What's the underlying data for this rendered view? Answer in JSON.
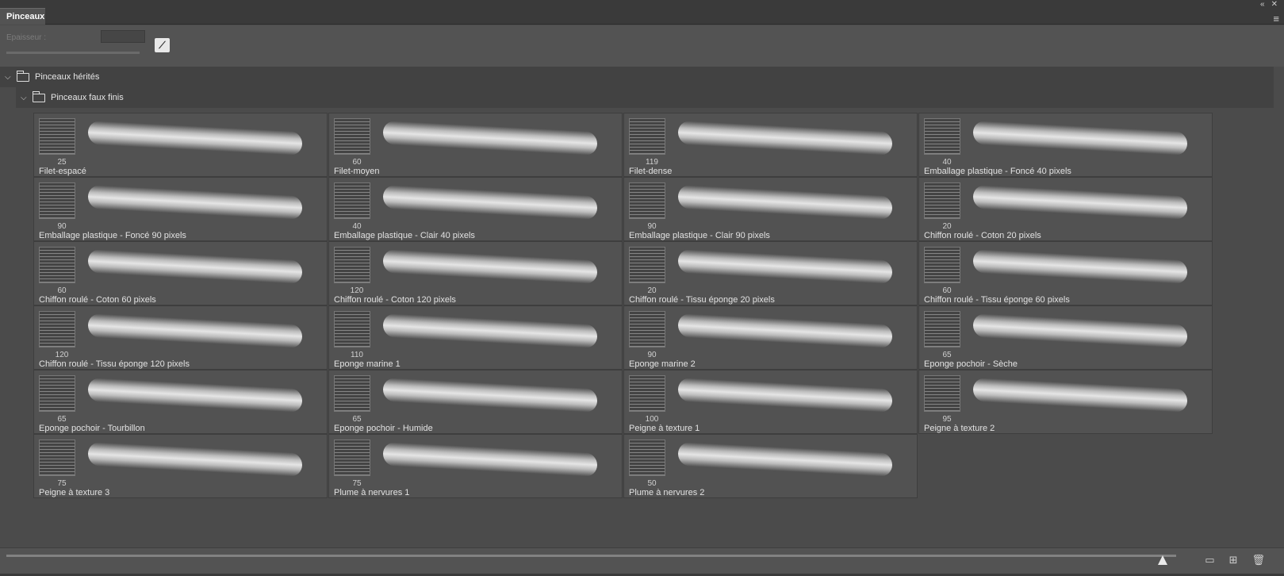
{
  "panel": {
    "tab_label": "Pinceaux",
    "collapse_icon": "double-chevron-left-icon",
    "close_icon": "close-icon",
    "menu_icon": "menu-icon"
  },
  "options": {
    "thickness_label": "Epaisseur :",
    "thickness_value": ""
  },
  "groups": {
    "parent": "Pinceaux hérités",
    "child": "Pinceaux faux finis"
  },
  "brushes": [
    {
      "name": "Filet-espacé",
      "size": "25"
    },
    {
      "name": "Filet-moyen",
      "size": "60"
    },
    {
      "name": "Filet-dense",
      "size": "119"
    },
    {
      "name": "Emballage plastique - Foncé 40 pixels",
      "size": "40"
    },
    {
      "name": "Emballage plastique - Foncé 90 pixels",
      "size": "90"
    },
    {
      "name": "Emballage plastique - Clair 40 pixels",
      "size": "40"
    },
    {
      "name": "Emballage plastique - Clair 90 pixels",
      "size": "90"
    },
    {
      "name": "Chiffon roulé - Coton 20 pixels",
      "size": "20"
    },
    {
      "name": "Chiffon roulé - Coton 60 pixels",
      "size": "60"
    },
    {
      "name": "Chiffon roulé - Coton 120 pixels",
      "size": "120"
    },
    {
      "name": "Chiffon roulé - Tissu éponge 20 pixels",
      "size": "20"
    },
    {
      "name": "Chiffon roulé - Tissu éponge 60 pixels",
      "size": "60"
    },
    {
      "name": "Chiffon roulé - Tissu éponge 120 pixels",
      "size": "120"
    },
    {
      "name": "Eponge marine 1",
      "size": "110"
    },
    {
      "name": "Eponge marine 2",
      "size": "90"
    },
    {
      "name": "Eponge pochoir - Sèche",
      "size": "65"
    },
    {
      "name": "Eponge pochoir - Tourbillon",
      "size": "65"
    },
    {
      "name": "Eponge pochoir - Humide",
      "size": "65"
    },
    {
      "name": "Peigne à texture 1",
      "size": "100"
    },
    {
      "name": "Peigne à texture 2",
      "size": "95"
    },
    {
      "name": "Peigne à texture 3",
      "size": "75"
    },
    {
      "name": "Plume à nervures 1",
      "size": "75"
    },
    {
      "name": "Plume à nervures 2",
      "size": "50"
    }
  ],
  "footer": {
    "new_folder_icon": "folder-icon",
    "new_brush_icon": "plus-square-icon",
    "delete_icon": "trash-icon"
  }
}
